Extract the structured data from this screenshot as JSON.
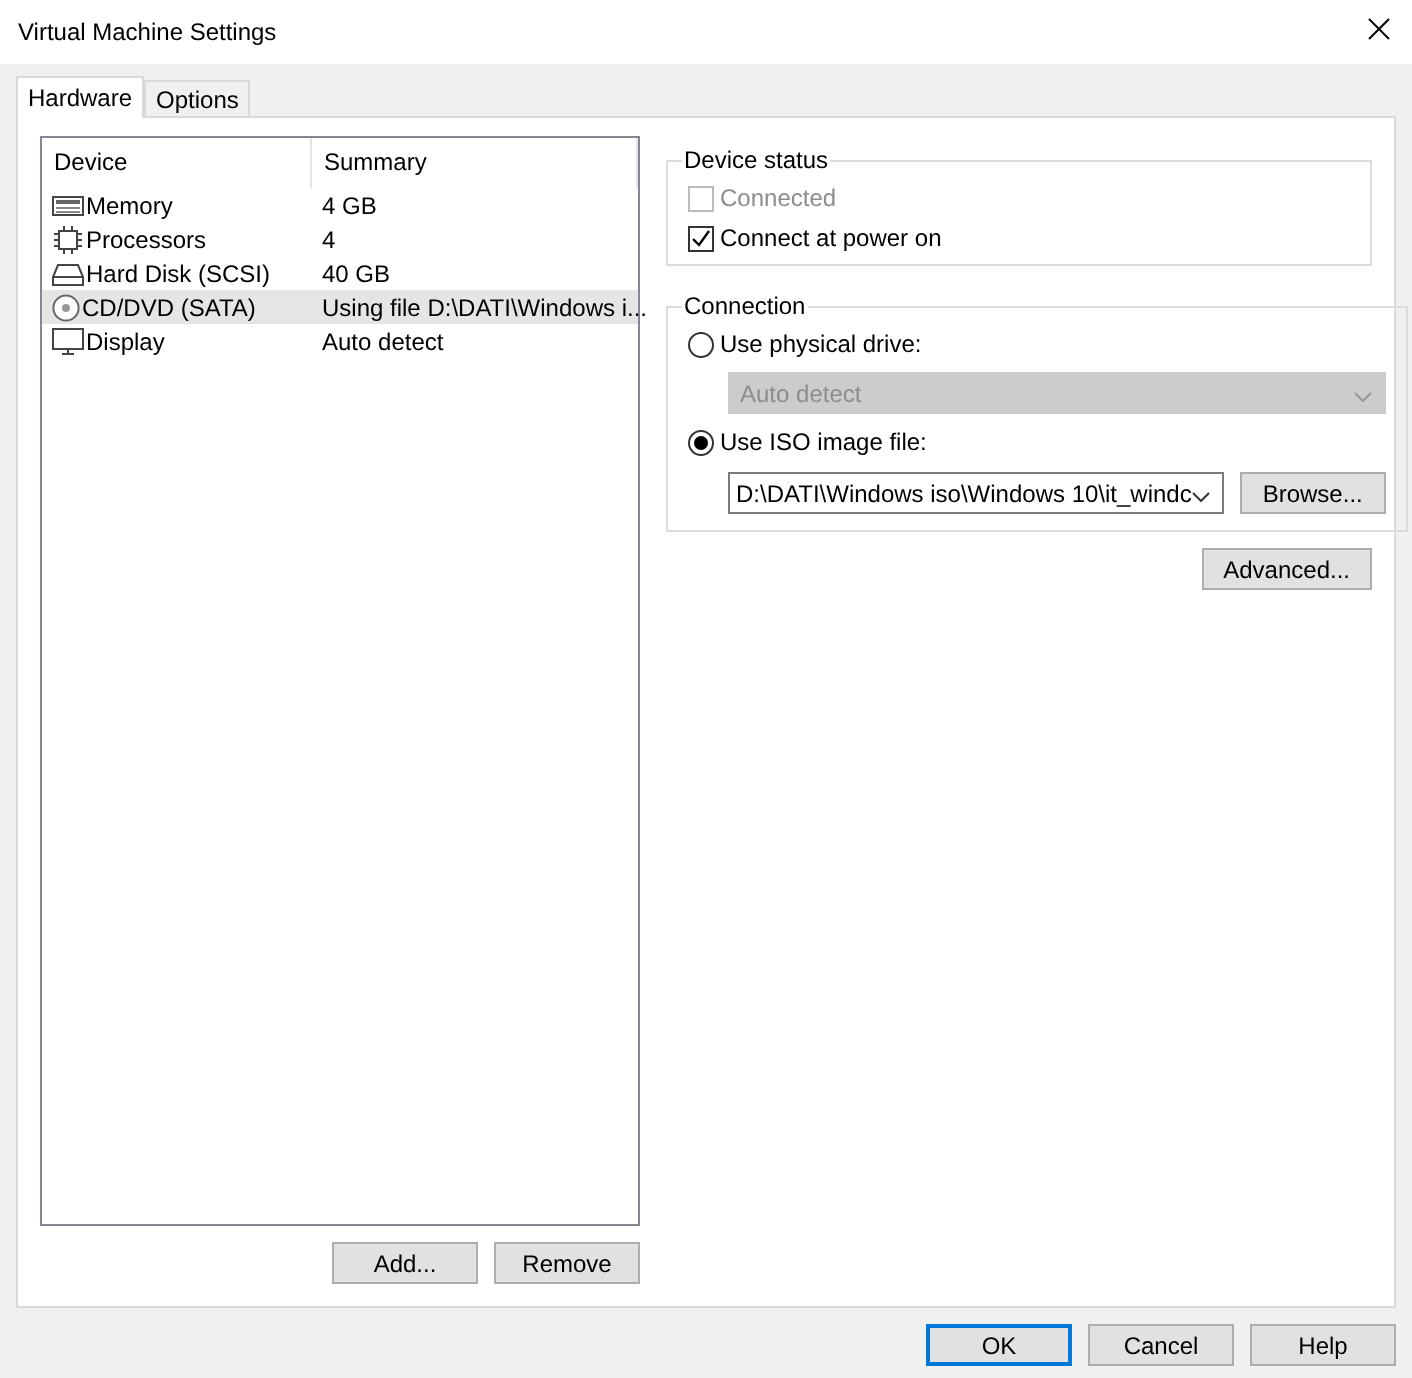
{
  "window": {
    "title": "Virtual Machine Settings"
  },
  "tabs": [
    {
      "label": "Hardware",
      "selected": true
    },
    {
      "label": "Options",
      "selected": false
    }
  ],
  "device_list": {
    "columns": [
      "Device",
      "Summary"
    ],
    "rows": [
      {
        "kind": "memory",
        "device": "Memory",
        "summary": "4 GB",
        "selected": false
      },
      {
        "kind": "processor",
        "device": "Processors",
        "summary": "4",
        "selected": false
      },
      {
        "kind": "disk",
        "device": "Hard Disk (SCSI)",
        "summary": "40 GB",
        "selected": false
      },
      {
        "kind": "cd",
        "device": "CD/DVD (SATA)",
        "summary": "Using file D:\\DATI\\Windows i...",
        "selected": true
      },
      {
        "kind": "display",
        "device": "Display",
        "summary": "Auto detect",
        "selected": false
      }
    ],
    "buttons": [
      "Add...",
      "Remove"
    ]
  },
  "device_status": {
    "title": "Device status",
    "options": [
      {
        "label": "Connected",
        "checked": false,
        "disabled": true
      },
      {
        "label": "Connect at power on",
        "checked": true,
        "disabled": false
      }
    ]
  },
  "connection": {
    "title": "Connection",
    "physical": {
      "label": "Use physical drive:",
      "selected": false,
      "dropdown": {
        "value": "Auto detect",
        "disabled": true
      }
    },
    "iso": {
      "label": "Use ISO image file:",
      "selected": true,
      "value": "D:\\DATI\\Windows iso\\Windows 10\\it_windc",
      "browse": "Browse..."
    }
  },
  "advanced_button": "Advanced...",
  "footer_buttons": [
    {
      "label": "OK",
      "default": true
    },
    {
      "label": "Cancel",
      "default": false
    },
    {
      "label": "Help",
      "default": false
    }
  ]
}
